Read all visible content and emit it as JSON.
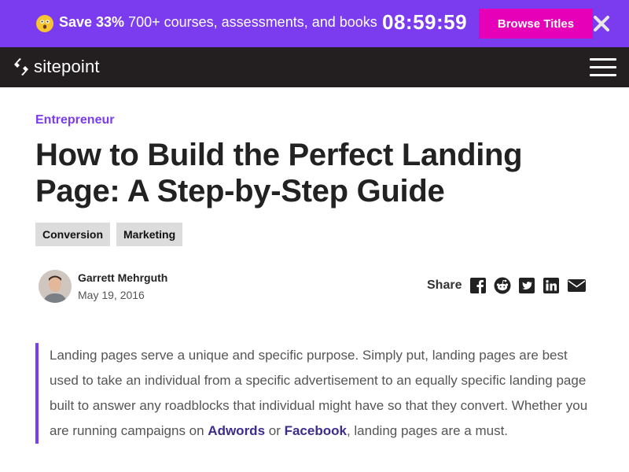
{
  "promo": {
    "highlight": "Save 33%",
    "text": "700+ courses, assessments, and books",
    "timer": "08:59:59",
    "button_label": "Browse Titles",
    "close_icon": "close-icon",
    "emoji_icon": "astonished-face-icon"
  },
  "nav": {
    "logo_text": "sitepoint",
    "menu_icon": "hamburger-menu-icon"
  },
  "article": {
    "category": "Entrepreneur",
    "title": "How to Build the Perfect Landing Page: A Step-by-Step Guide",
    "tags": [
      "Conversion",
      "Marketing"
    ],
    "author_name": "Garrett Mehrguth",
    "date": "May 19, 2016",
    "share_label": "Share",
    "share_icons": [
      "facebook-icon",
      "reddit-icon",
      "twitter-icon",
      "linkedin-icon",
      "email-icon"
    ],
    "intro_part1": "Landing pages serve a unique and specific purpose. Simply put, landing pages are best used to take an individual from a specific advertisement to an equally specific landing page built to answer any roadblocks that individual might have so that they convert. Whether you are running campaigns on ",
    "link1": "Adwords",
    "intro_part2": " or ",
    "link2": "Facebook",
    "intro_part3": ", landing pages are a must."
  },
  "colors": {
    "accent": "#7b3cf0",
    "promo_button": "#e600b8",
    "nav_bg": "#231f20",
    "link": "#3d2c8d"
  }
}
